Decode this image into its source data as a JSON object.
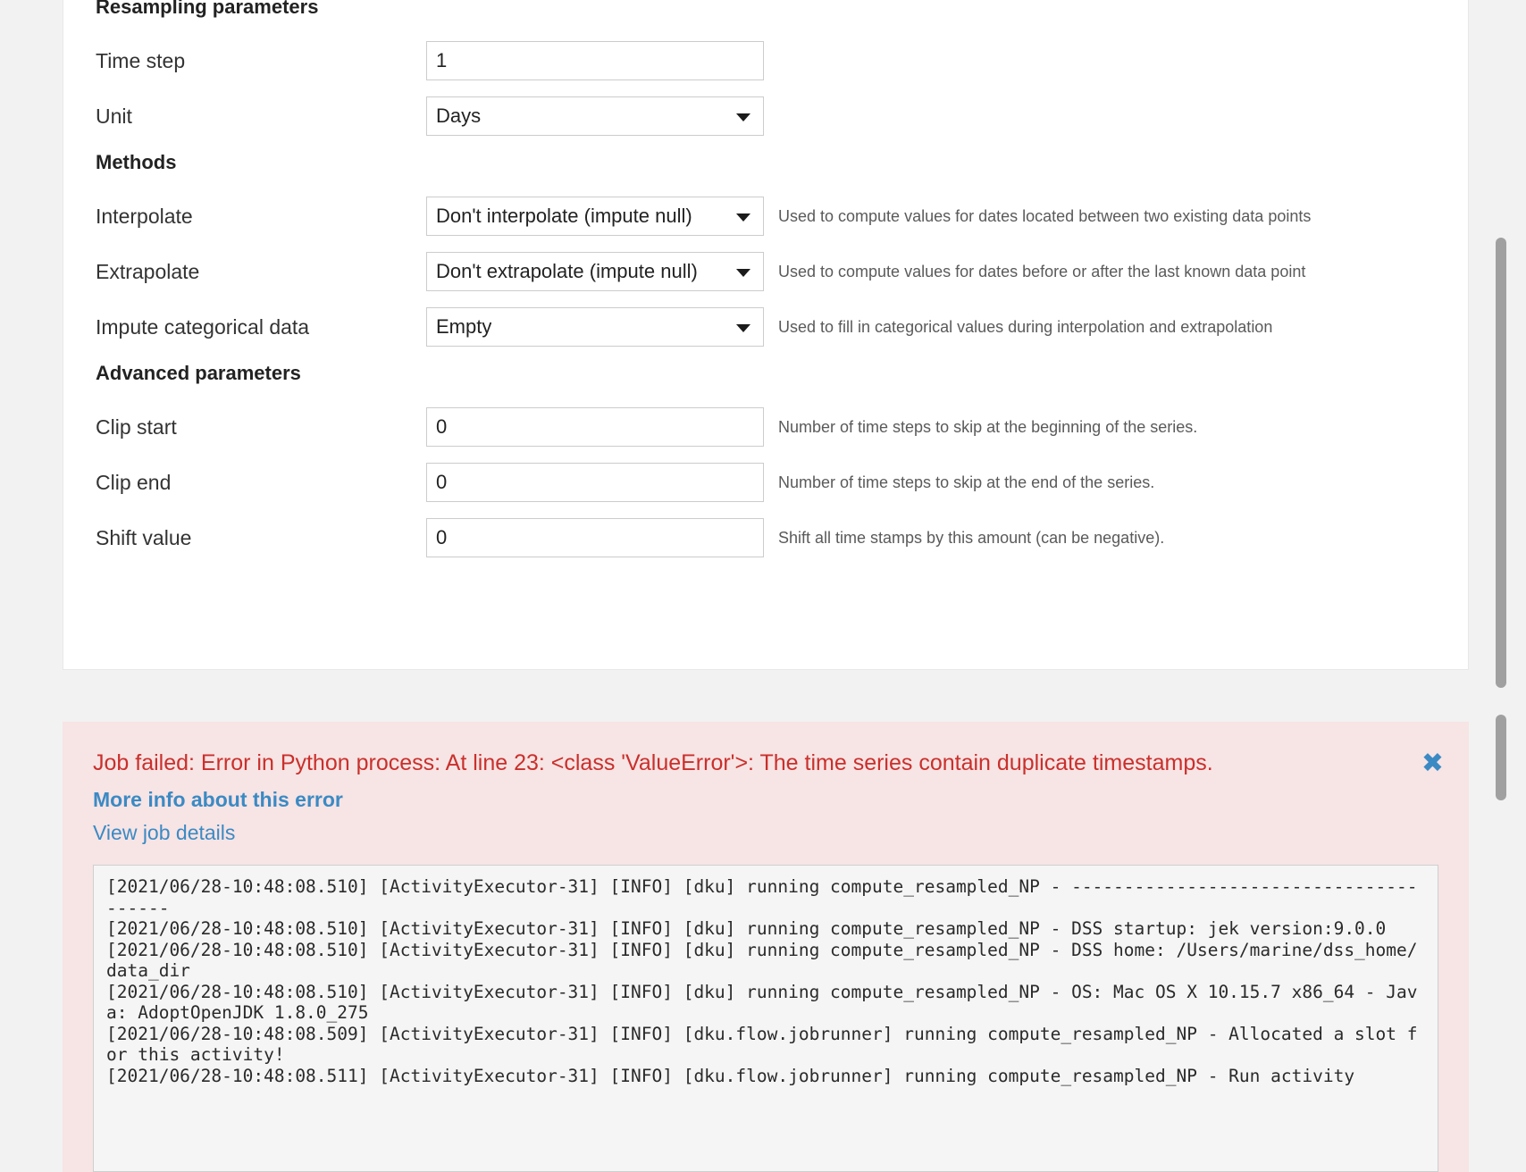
{
  "form": {
    "sections": {
      "resampling": "Resampling parameters",
      "methods": "Methods",
      "advanced": "Advanced parameters"
    },
    "fields": {
      "time_step": {
        "label": "Time step",
        "value": "1",
        "help": ""
      },
      "unit": {
        "label": "Unit",
        "value": "Days",
        "help": ""
      },
      "interpolate": {
        "label": "Interpolate",
        "value": "Don't interpolate (impute null)",
        "help": "Used to compute values for dates located between two existing data points"
      },
      "extrapolate": {
        "label": "Extrapolate",
        "value": "Don't extrapolate (impute null)",
        "help": "Used to compute values for dates before or after the last known data point"
      },
      "impute_categorical": {
        "label": "Impute categorical data",
        "value": "Empty",
        "help": "Used to fill in categorical values during interpolation and extrapolation"
      },
      "clip_start": {
        "label": "Clip start",
        "value": "0",
        "help": "Number of time steps to skip at the beginning of the series."
      },
      "clip_end": {
        "label": "Clip end",
        "value": "0",
        "help": "Number of time steps to skip at the end of the series."
      },
      "shift_value": {
        "label": "Shift value",
        "value": "0",
        "help": "Shift all time stamps by this amount (can be negative)."
      }
    }
  },
  "error": {
    "title": "Job failed: Error in Python process: At line 23: <class 'ValueError'>: The time series contain duplicate timestamps.",
    "more_info_label": "More info about this error",
    "view_job_label": "View job details",
    "close_icon": "✖",
    "accent_red": "#c9302c",
    "accent_blue": "#3b8ac4",
    "background": "#f7e4e4",
    "log": "[2021/06/28-10:48:08.510] [ActivityExecutor-31] [INFO] [dku] running compute_resampled_NP - ---------------------------------------\n[2021/06/28-10:48:08.510] [ActivityExecutor-31] [INFO] [dku] running compute_resampled_NP - DSS startup: jek version:9.0.0\n[2021/06/28-10:48:08.510] [ActivityExecutor-31] [INFO] [dku] running compute_resampled_NP - DSS home: /Users/marine/dss_home/data_dir\n[2021/06/28-10:48:08.510] [ActivityExecutor-31] [INFO] [dku] running compute_resampled_NP - OS: Mac OS X 10.15.7 x86_64 - Java: AdoptOpenJDK 1.8.0_275\n[2021/06/28-10:48:08.509] [ActivityExecutor-31] [INFO] [dku.flow.jobrunner] running compute_resampled_NP - Allocated a slot for this activity!\n[2021/06/28-10:48:08.511] [ActivityExecutor-31] [INFO] [dku.flow.jobrunner] running compute_resampled_NP - Run activity"
  }
}
